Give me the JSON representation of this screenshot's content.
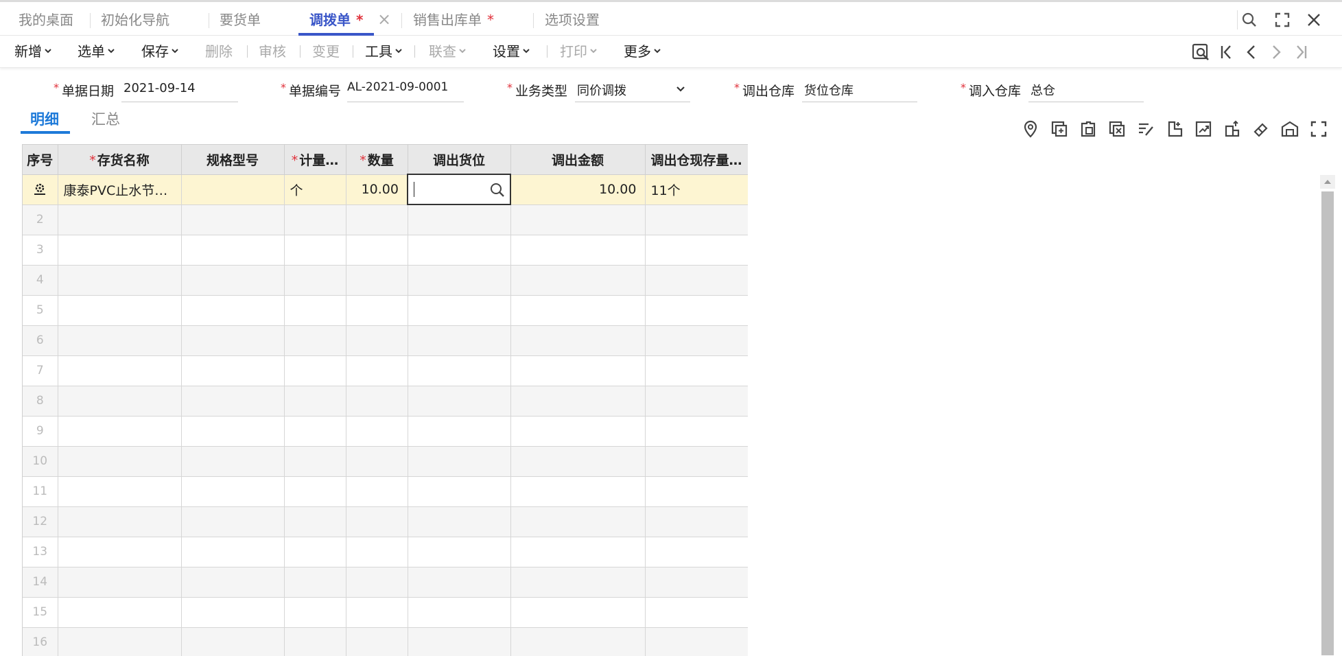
{
  "tabs": [
    {
      "label": "我的桌面",
      "star": ""
    },
    {
      "label": "初始化导航",
      "star": ""
    },
    {
      "label": "要货单",
      "star": ""
    },
    {
      "label": "调拨单",
      "star": "*"
    },
    {
      "label": "销售出库单",
      "star": "*"
    },
    {
      "label": "选项设置",
      "star": ""
    }
  ],
  "tab_close": "×",
  "toolbar": {
    "new": "新增",
    "pick": "选单",
    "save": "保存",
    "delete": "删除",
    "audit": "审核",
    "change": "变更",
    "tools": "工具",
    "query": "联查",
    "settings": "设置",
    "print": "打印",
    "more": "更多",
    "separator": "|"
  },
  "form": {
    "required_mark": "*",
    "date": {
      "label": "单据日期",
      "value": "2021-09-14"
    },
    "number": {
      "label": "单据编号",
      "value": "AL-2021-09-0001"
    },
    "biz_type": {
      "label": "业务类型",
      "value": "同价调拨"
    },
    "out_wh": {
      "label": "调出仓库",
      "value": "货位仓库"
    },
    "in_wh": {
      "label": "调入仓库",
      "value": "总仓"
    }
  },
  "subtabs": {
    "detail": "明细",
    "summary": "汇总"
  },
  "grid": {
    "headers": {
      "seq": "序号",
      "name": "存货名称",
      "spec": "规格型号",
      "unit": "计量…",
      "qty": "数量",
      "location": "调出货位",
      "amount": "调出金额",
      "stock": "调出仓现存量…"
    },
    "required_mark": "*",
    "row1": {
      "name": "康泰PVC止水节…",
      "spec": "",
      "unit": "个",
      "qty": "10.00",
      "location": "",
      "amount": "10.00",
      "stock": "11个"
    },
    "row_numbers": [
      "2",
      "3",
      "4",
      "5",
      "6",
      "7",
      "8",
      "9",
      "10",
      "11",
      "12",
      "13",
      "14",
      "15",
      "16"
    ]
  },
  "colors": {
    "accent": "#3a56c8",
    "link": "#1e7ad9",
    "required": "#e0303a",
    "selected_row": "#fdf5d2"
  }
}
